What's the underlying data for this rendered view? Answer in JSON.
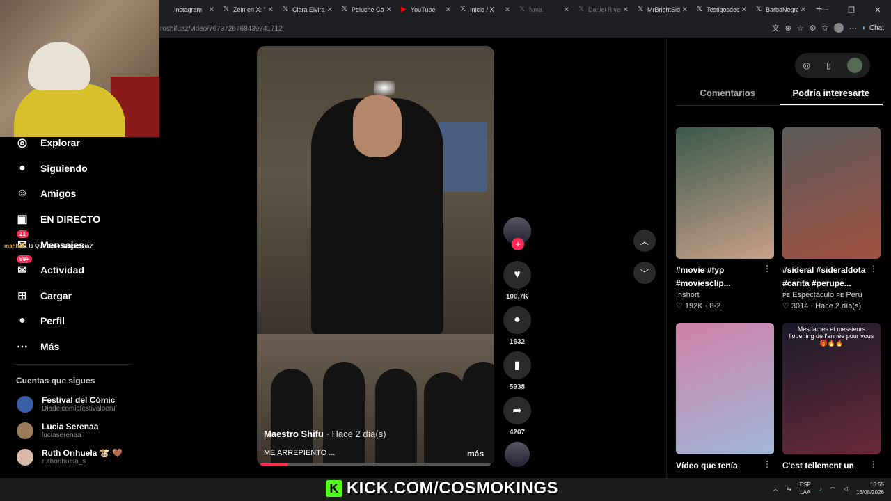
{
  "browser": {
    "tabs": [
      {
        "label": "Instagram",
        "icon": "instagram-icon",
        "dim": false
      },
      {
        "label": "Zein en X: \"V",
        "icon": "x-icon",
        "dim": false
      },
      {
        "label": "Clara Elvira O",
        "icon": "x-icon",
        "dim": false
      },
      {
        "label": "Peluche Calig",
        "icon": "x-icon",
        "dim": false
      },
      {
        "label": "YouTube",
        "icon": "youtube-icon",
        "dim": false
      },
      {
        "label": "Inicio / X",
        "icon": "x-icon",
        "dim": false
      },
      {
        "label": "Nma",
        "icon": "x-icon",
        "dim": true
      },
      {
        "label": "Daniel Rivera",
        "icon": "x-icon",
        "dim": true
      },
      {
        "label": "MrBrightSide",
        "icon": "x-icon",
        "dim": false
      },
      {
        "label": "Testigosdeca",
        "icon": "x-icon",
        "dim": false
      },
      {
        "label": "BarbaNegra",
        "icon": "x-icon",
        "dim": false
      }
    ],
    "new_tab": "+",
    "url": "roshifuaz/video/7673726768439741712",
    "chat_label": "Chat"
  },
  "sidebar": {
    "items": [
      {
        "label": "Explorar",
        "icon": "compass-icon",
        "glyph": "◎"
      },
      {
        "label": "Siguiendo",
        "icon": "following-avatar-icon",
        "glyph": "●"
      },
      {
        "label": "Amigos",
        "icon": "friends-icon",
        "glyph": "☺"
      },
      {
        "label": "EN DIRECTO",
        "icon": "live-tv-icon",
        "glyph": "▣"
      },
      {
        "label": "Mensajes",
        "icon": "messages-icon",
        "glyph": "✉",
        "badge": "21"
      },
      {
        "label": "Actividad",
        "icon": "activity-icon",
        "glyph": "✉",
        "badge": "99+"
      },
      {
        "label": "Cargar",
        "icon": "upload-icon",
        "glyph": "⊞"
      },
      {
        "label": "Perfil",
        "icon": "profile-avatar-icon",
        "glyph": "●"
      },
      {
        "label": "Más",
        "icon": "more-dots-icon",
        "glyph": "⋯"
      }
    ],
    "chat_overlay": {
      "user": "mahh45",
      "text": ": Is Que tiene residencia?"
    },
    "following_title": "Cuentas que sigues",
    "following": [
      {
        "name": "Festival del Cómic",
        "handle": "Diadelcomicfestivalperu",
        "color": "#3a5fa8"
      },
      {
        "name": "Lucia Serenaa",
        "handle": "luciaserenaa",
        "color": "#9a7a5a"
      },
      {
        "name": "Ruth Orihuela 🐮 🤎",
        "handle": "ruthorihuela_s",
        "color": "#d8b8a8"
      }
    ]
  },
  "video": {
    "author": "Maestro Shifu",
    "time": "· Hace 2 día(s)",
    "description": "ME ARREPIENTO ...",
    "more": "más",
    "progress": 0.12
  },
  "actions": {
    "likes": "100,7K",
    "comments": "1632",
    "saves": "5938",
    "shares": "4207"
  },
  "right_panel": {
    "tabs": [
      "Comentarios",
      "Podría interesarte"
    ],
    "active_tab": 1,
    "cards": [
      {
        "title": "#movie #fyp #moviesclip...",
        "author": "Inshort",
        "stats": "♡ 192K · 8-2",
        "thumb_colors": [
          "#3a5a4a",
          "#c9a08a"
        ]
      },
      {
        "title": "#sideral #sideraldota #carita #perupe...",
        "author": "ᴘᴇ Espectáculo ᴘᴇ Perú",
        "stats": "♡ 3014 · Hace 2 día(s)",
        "thumb_colors": [
          "#5a5a5a",
          "#a05040"
        ]
      },
      {
        "title": "Vídeo que tenía",
        "author": "",
        "stats": "",
        "thumb_colors": [
          "#d080a8",
          "#a0b8d8"
        ]
      },
      {
        "title": "C'est tellement un",
        "author": "",
        "stats": "",
        "thumb_colors": [
          "#1a1a2a",
          "#6a2a3a"
        ],
        "overlay": "Mesdames et messieurs l'opening de l'année pour vous 🎁🔥🔥"
      }
    ]
  },
  "overlay": {
    "kick_letter": "K",
    "kick_text": "KICK.COM/COSMOKINGS"
  },
  "taskbar": {
    "lang_top": "ESP",
    "lang_bottom": "LAA",
    "time": "16:55",
    "date": "16/08/2026"
  }
}
